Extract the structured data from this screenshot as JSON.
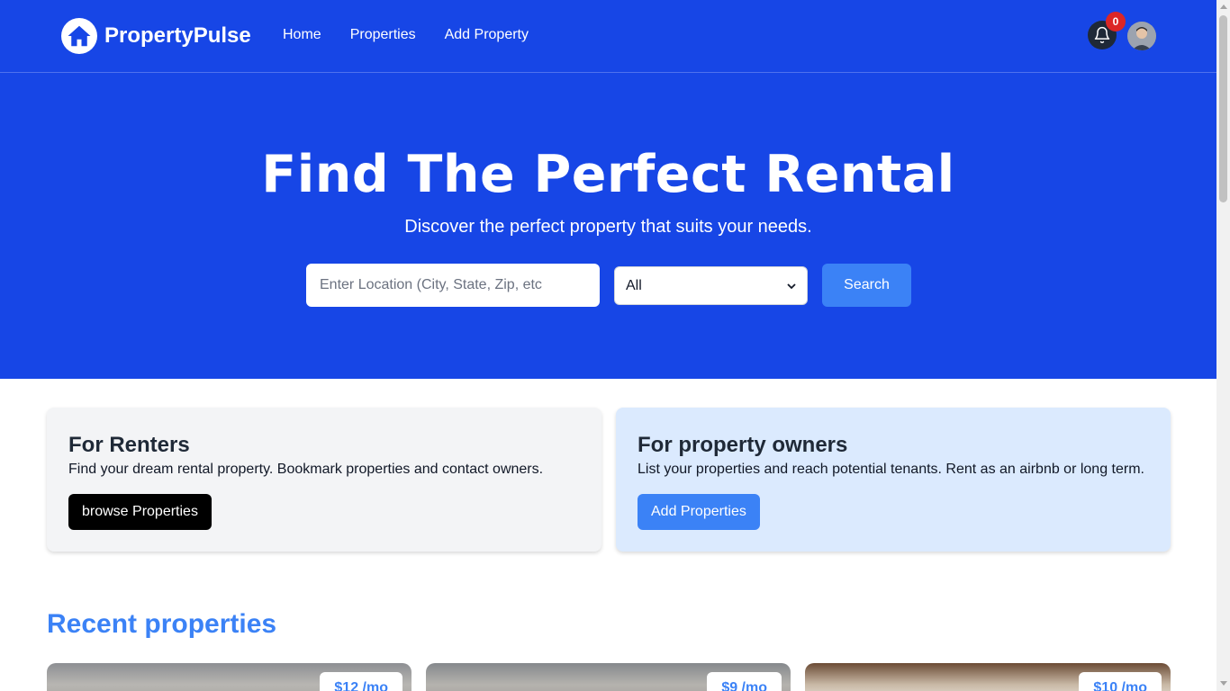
{
  "brand": {
    "name": "PropertyPulse",
    "logo_icon": "house-icon"
  },
  "nav": {
    "items": [
      {
        "label": "Home"
      },
      {
        "label": "Properties"
      },
      {
        "label": "Add Property"
      }
    ]
  },
  "notifications": {
    "icon": "bell-icon",
    "count": "0"
  },
  "hero": {
    "title": "Find The Perfect Rental",
    "subtitle": "Discover the perfect property that suits your needs.",
    "search": {
      "placeholder": "Enter Location (City, State, Zip, etc",
      "select_value": "All",
      "button_label": "Search"
    }
  },
  "info": {
    "renters": {
      "title": "For Renters",
      "text": "Find your dream rental property. Bookmark properties and contact owners.",
      "button_label": "browse Properties"
    },
    "owners": {
      "title": "For property owners",
      "text": "List your properties and reach potential tenants. Rent as an airbnb or long term.",
      "button_label": "Add Properties"
    }
  },
  "recent": {
    "title": "Recent properties",
    "properties": [
      {
        "price": "$12 /mo"
      },
      {
        "price": "$9 /mo"
      },
      {
        "price": "$10 /mo"
      }
    ]
  },
  "colors": {
    "primary": "#1746e6",
    "accent": "#3b82f6",
    "badge": "#dc2626"
  }
}
